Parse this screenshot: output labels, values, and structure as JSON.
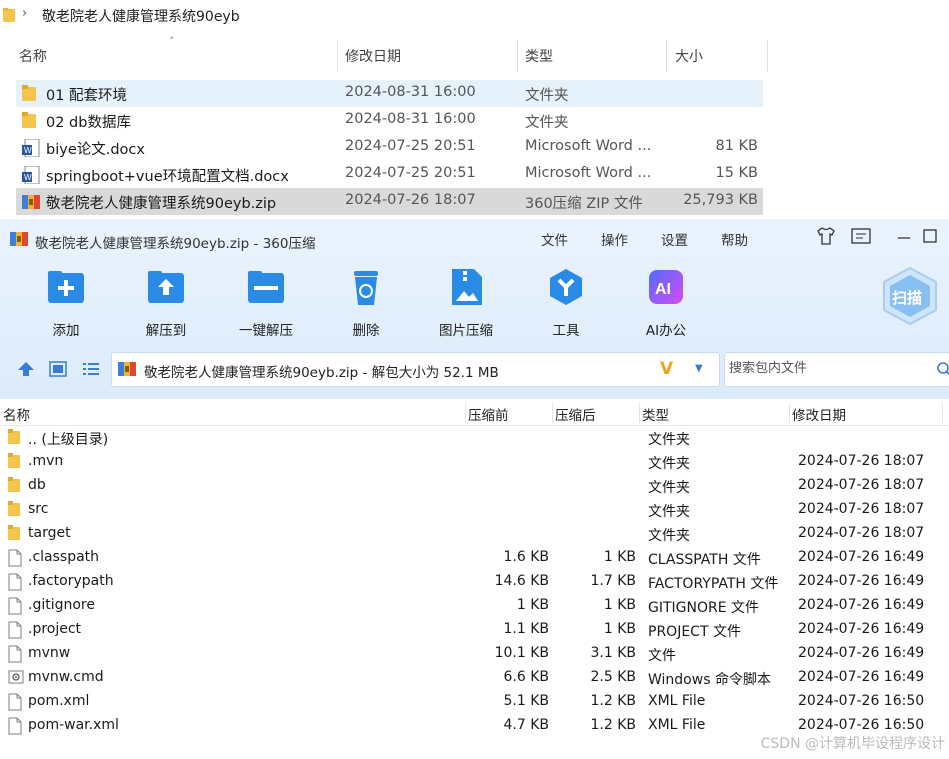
{
  "explorer": {
    "breadcrumb": "敬老院老人健康管理系统90eyb",
    "columns": {
      "name": "名称",
      "date": "修改日期",
      "type": "类型",
      "size": "大小"
    },
    "rows": [
      {
        "name": "01 配套环境",
        "date": "2024-08-31 16:00",
        "type": "文件夹",
        "size": "",
        "icon": "folder-icon",
        "state": "hover"
      },
      {
        "name": "02 db数据库",
        "date": "2024-08-31 16:00",
        "type": "文件夹",
        "size": "",
        "icon": "folder-icon",
        "state": ""
      },
      {
        "name": "biye论文.docx",
        "date": "2024-07-25 20:51",
        "type": "Microsoft Word ...",
        "size": "81 KB",
        "icon": "word-doc-icon",
        "state": ""
      },
      {
        "name": "springboot+vue环境配置文档.docx",
        "date": "2024-07-25 20:51",
        "type": "Microsoft Word ...",
        "size": "15 KB",
        "icon": "word-doc-icon",
        "state": ""
      },
      {
        "name": "敬老院老人健康管理系统90eyb.zip",
        "date": "2024-07-26 18:07",
        "type": "360压缩 ZIP 文件",
        "size": "25,793 KB",
        "icon": "zip-archive-icon",
        "state": "selected"
      }
    ]
  },
  "zip_window": {
    "title": "敬老院老人健康管理系统90eyb.zip - 360压缩",
    "menu": [
      "文件",
      "操作",
      "设置",
      "帮助"
    ],
    "toolbar": [
      {
        "label": "添加",
        "icon": "add-icon"
      },
      {
        "label": "解压到",
        "icon": "extract-to-icon"
      },
      {
        "label": "一键解压",
        "icon": "one-click-extract-icon"
      },
      {
        "label": "删除",
        "icon": "delete-icon"
      },
      {
        "label": "图片压缩",
        "icon": "image-compress-icon"
      },
      {
        "label": "工具",
        "icon": "tools-icon"
      },
      {
        "label": "AI办公",
        "icon": "ai-office-icon"
      }
    ],
    "scan_label": "扫描",
    "path_text": "敬老院老人健康管理系统90eyb.zip - 解包大小为 52.1 MB",
    "search_placeholder": "搜索包内文件",
    "columns": {
      "name": "名称",
      "before": "压缩前",
      "after": "压缩后",
      "type": "类型",
      "date": "修改日期"
    },
    "rows": [
      {
        "name": ".. (上级目录)",
        "before": "",
        "after": "",
        "type": "文件夹",
        "date": "",
        "icon": "folder-icon"
      },
      {
        "name": ".mvn",
        "before": "",
        "after": "",
        "type": "文件夹",
        "date": "2024-07-26 18:07",
        "icon": "folder-icon"
      },
      {
        "name": "db",
        "before": "",
        "after": "",
        "type": "文件夹",
        "date": "2024-07-26 18:07",
        "icon": "folder-icon"
      },
      {
        "name": "src",
        "before": "",
        "after": "",
        "type": "文件夹",
        "date": "2024-07-26 18:07",
        "icon": "folder-icon"
      },
      {
        "name": "target",
        "before": "",
        "after": "",
        "type": "文件夹",
        "date": "2024-07-26 18:07",
        "icon": "folder-icon"
      },
      {
        "name": ".classpath",
        "before": "1.6 KB",
        "after": "1 KB",
        "type": "CLASSPATH 文件",
        "date": "2024-07-26 16:49",
        "icon": "file-icon"
      },
      {
        "name": ".factorypath",
        "before": "14.6 KB",
        "after": "1.7 KB",
        "type": "FACTORYPATH 文件",
        "date": "2024-07-26 16:49",
        "icon": "file-icon"
      },
      {
        "name": ".gitignore",
        "before": "1 KB",
        "after": "1 KB",
        "type": "GITIGNORE 文件",
        "date": "2024-07-26 16:49",
        "icon": "file-icon"
      },
      {
        "name": ".project",
        "before": "1.1 KB",
        "after": "1 KB",
        "type": "PROJECT 文件",
        "date": "2024-07-26 16:49",
        "icon": "file-icon"
      },
      {
        "name": "mvnw",
        "before": "10.1 KB",
        "after": "3.1 KB",
        "type": "文件",
        "date": "2024-07-26 16:49",
        "icon": "file-icon"
      },
      {
        "name": "mvnw.cmd",
        "before": "6.6 KB",
        "after": "2.5 KB",
        "type": "Windows 命令脚本",
        "date": "2024-07-26 16:49",
        "icon": "cmd-script-icon"
      },
      {
        "name": "pom.xml",
        "before": "5.1 KB",
        "after": "1.2 KB",
        "type": "XML File",
        "date": "2024-07-26 16:50",
        "icon": "file-icon"
      },
      {
        "name": "pom-war.xml",
        "before": "4.7 KB",
        "after": "1.2 KB",
        "type": "XML File",
        "date": "2024-07-26 16:50",
        "icon": "file-icon"
      }
    ]
  },
  "watermark": "CSDN @计算机毕设程序设计"
}
